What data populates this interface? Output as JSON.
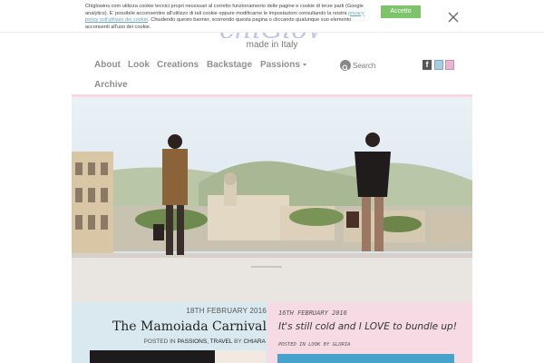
{
  "cookie_banner": {
    "text_before_link": "Chiglowins.com utilizza cookie tecnici propri necessari al corretto funzionamento delle pagine e cookie di terze parti (Google analytics). E' possibile acconsentire all'utilizzo di tali cookie oppure modificarne le impostazioni consultando la nostra ",
    "link_text": "privacy policy sull'utilizzo dei cookie",
    "text_after_link": ". Chiudendo questo banner, scorrendo questa pagina o cliccando qualunque suo elemento acconsenti all'uso dei cookie.",
    "accept_label": "Accetto",
    "accept_color": "#7cc36a"
  },
  "logo": {
    "wordmark": "chiGlow",
    "tagline": "made in Italy"
  },
  "nav": {
    "items": [
      "About",
      "Look",
      "Creations",
      "Backstage",
      "Passions",
      "Archive"
    ],
    "search_label": "Search",
    "social_icons": [
      "facebook-icon",
      "instagram-icon",
      "pinterest-icon"
    ],
    "facebook_glyph": "f"
  },
  "colors": {
    "nav_text": "#8f8f8f",
    "divider_pink": "#f8d7e3",
    "card_blue": "#d9e9ef",
    "card_pink": "#f6dbe5"
  },
  "posts": [
    {
      "date": "18TH FEBRUARY 2016",
      "title": "The Mamoiada Carnival",
      "meta_prefix": "POSTED IN",
      "meta_categories": "PASSIONS, TRAVEL",
      "meta_by": "BY",
      "meta_author": "CHIARA"
    },
    {
      "date": "16TH FEBRUARY 2016",
      "title": "It's still cold and I LOVE to bundle up!",
      "meta": "POSTED IN LOOK BY GLORIA"
    }
  ]
}
